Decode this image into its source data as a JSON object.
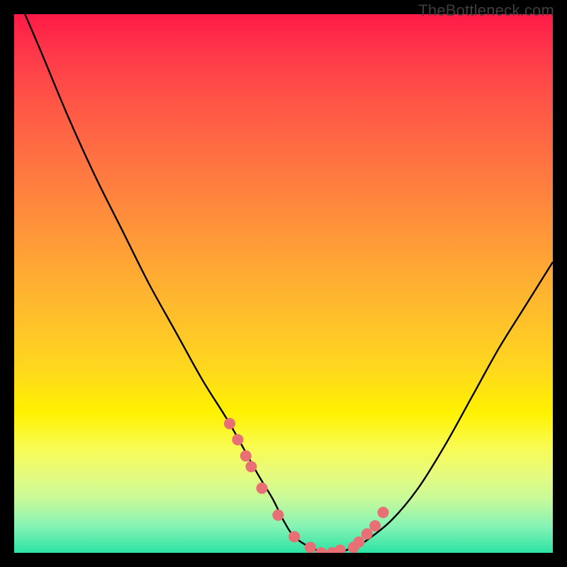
{
  "watermark": "TheBottleneck.com",
  "chart_data": {
    "type": "line",
    "title": "",
    "xlabel": "",
    "ylabel": "",
    "xlim": [
      0,
      100
    ],
    "ylim": [
      0,
      100
    ],
    "series": [
      {
        "name": "bottleneck-curve",
        "x": [
          2,
          5,
          10,
          15,
          20,
          25,
          30,
          35,
          40,
          45,
          48,
          50,
          52,
          55,
          58,
          60,
          63,
          65,
          70,
          75,
          80,
          85,
          90,
          95,
          100
        ],
        "y": [
          100,
          93,
          81,
          70,
          60,
          50,
          41,
          32,
          24,
          15,
          10,
          6,
          3,
          1,
          0,
          0,
          1,
          2,
          6,
          12,
          20,
          29,
          38,
          46,
          54
        ]
      }
    ],
    "markers": {
      "name": "highlight-dots",
      "color": "#e86f74",
      "x": [
        40,
        41.5,
        43,
        44,
        46,
        49,
        52,
        55,
        57,
        59,
        60.5,
        63,
        64,
        65.5,
        67,
        68.5
      ],
      "y": [
        24,
        21,
        18,
        16,
        12,
        7,
        3,
        1,
        0,
        0,
        0.5,
        1,
        2,
        3.5,
        5,
        7.5
      ]
    },
    "gradient_stops": [
      {
        "pos": 0,
        "color": "#ff1a47"
      },
      {
        "pos": 30,
        "color": "#ff7a40"
      },
      {
        "pos": 66,
        "color": "#ffd81e"
      },
      {
        "pos": 100,
        "color": "#2ce3a4"
      }
    ],
    "background": "#000000"
  }
}
